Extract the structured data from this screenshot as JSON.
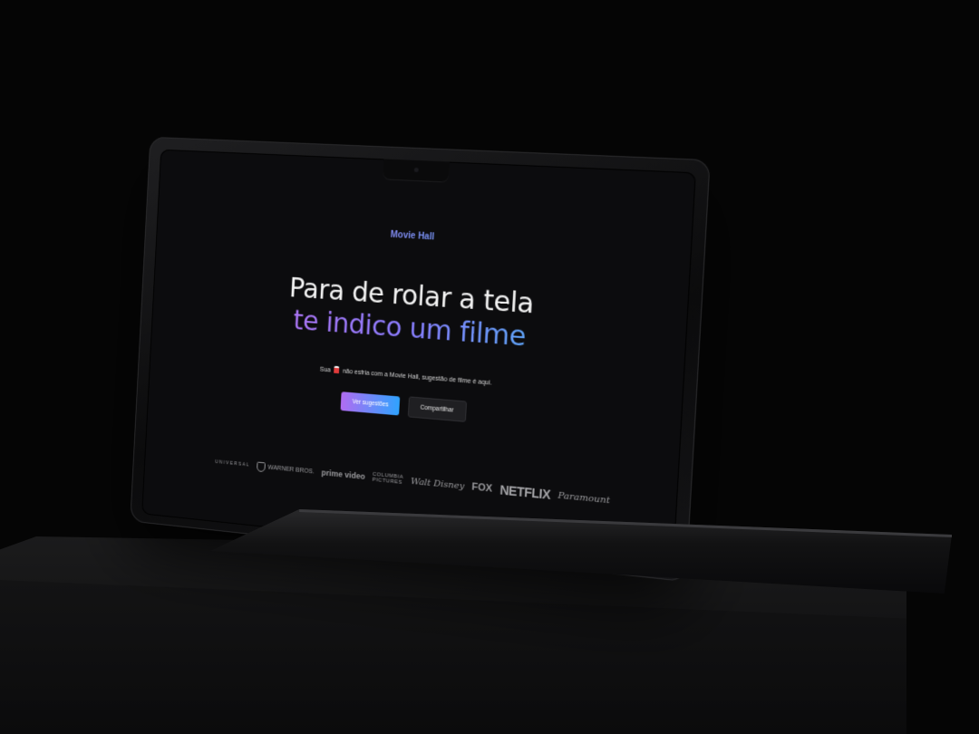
{
  "site": {
    "brand": "Movie Hall",
    "hero_line1": "Para de rolar a tela",
    "hero_line2": "te indico um filme",
    "subtitle_pre": "Sua",
    "subtitle_post": "não esfria com a Movie Hall, sugestão de filme é aqui.",
    "subtitle_icon": "popcorn-icon",
    "primary_button": "Ver sugestões",
    "secondary_button": "Compartilhar"
  },
  "logos": {
    "universal": "UNIVERSAL",
    "warner": "WARNER BROS.",
    "prime": "prime video",
    "columbia_line1": "COLUMBIA",
    "columbia_line2": "PICTURES",
    "disney": "Walt Disney",
    "fox": "FOX",
    "netflix": "NETFLIX",
    "paramount": "Paramount"
  },
  "colors": {
    "gradient_start": "#c66cf1",
    "gradient_mid": "#8a7dff",
    "gradient_end": "#27d4ee",
    "background": "#0c0c0e"
  }
}
